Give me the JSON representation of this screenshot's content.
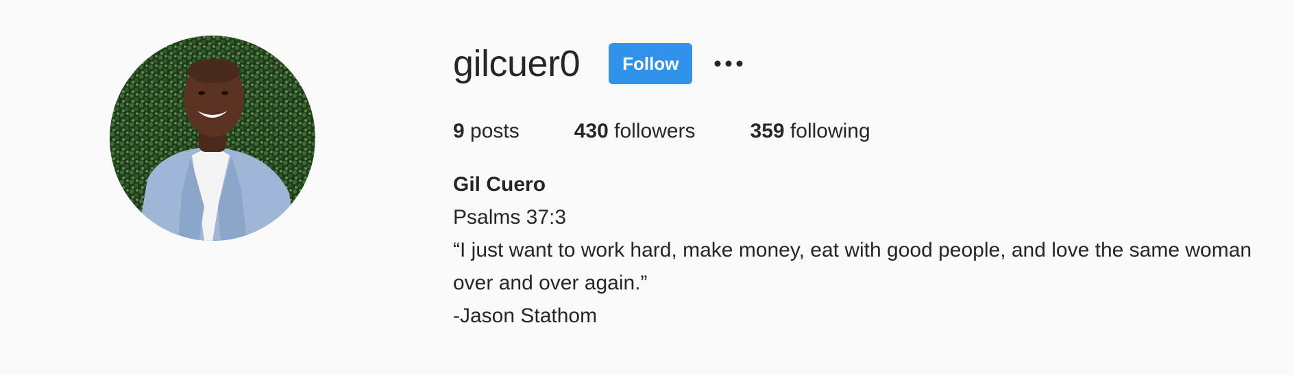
{
  "profile": {
    "username": "gilcuer0",
    "follow_label": "Follow",
    "more_icon": "more-horizontal-icon",
    "accent_color": "#3192ea"
  },
  "stats": [
    {
      "count": "9",
      "label": "posts"
    },
    {
      "count": "430",
      "label": "followers"
    },
    {
      "count": "359",
      "label": "following"
    }
  ],
  "bio": {
    "full_name": "Gil Cuero",
    "line1": "Psalms 37:3",
    "line2": "“I just want to work hard, make money, eat with good people, and love the same woman over and over again.”",
    "line3": "-Jason Stathom"
  }
}
